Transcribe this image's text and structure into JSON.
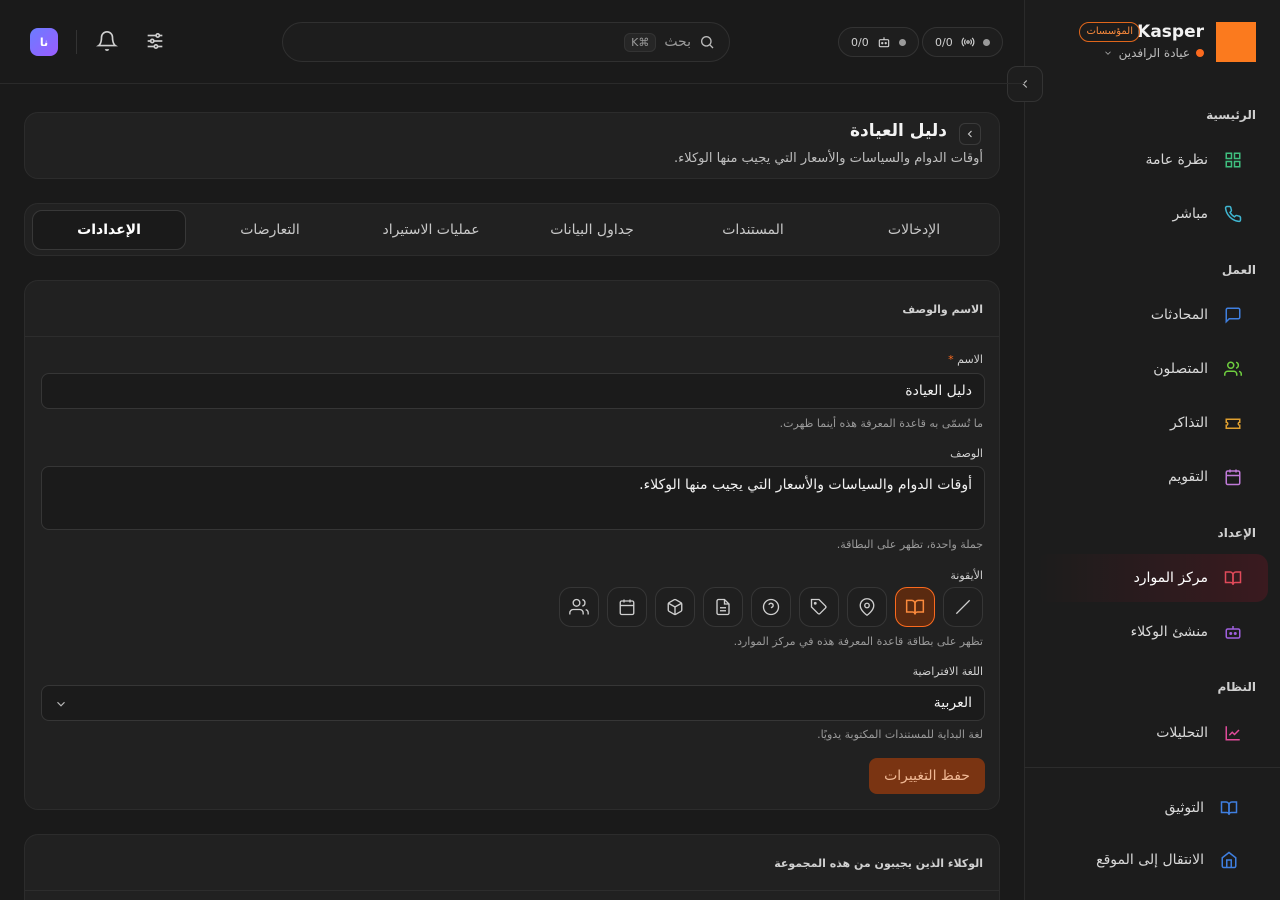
{
  "brand": {
    "name": "Kasper",
    "badge": "المؤسسات",
    "org": "عيادة الرافدين",
    "logo_color": "#fb7a1e"
  },
  "topbar": {
    "search_label": "بحث",
    "search_kbd": "⌘K",
    "stat1": "0/0",
    "stat2": "0/0",
    "avatar_text": "نا"
  },
  "sidebar": {
    "sections": {
      "home": "الرئيسية",
      "work": "العمل",
      "setup": "الإعداد",
      "system": "النظام"
    },
    "items": {
      "overview": "نظرة عامة",
      "live": "مباشر",
      "conversations": "المحادثات",
      "contacts": "المتصلون",
      "tickets": "التذاكر",
      "calendar": "التقويم",
      "resources": "مركز الموارد",
      "agent_builder": "منشئ الوكلاء",
      "analytics": "التحليلات",
      "docs": "التوثيق",
      "go_to_site": "الانتقال إلى الموقع"
    }
  },
  "page": {
    "title": "دليل العيادة",
    "subtitle": "أوقات الدوام والسياسات والأسعار التي يجيب منها الوكلاء."
  },
  "tabs": [
    "الإدخالات",
    "المستندات",
    "جداول البيانات",
    "عمليات الاستيراد",
    "التعارضات",
    "الإعدادات"
  ],
  "active_tab": "الإعدادات",
  "form": {
    "section_title": "الاسم والوصف",
    "name_label": "الاسم",
    "required_mark": "*",
    "name_value": "دليل العيادة",
    "name_help": "ما تُسمّى به قاعدة المعرفة هذه أينما ظهرت.",
    "desc_label": "الوصف",
    "desc_value": "أوقات الدوام والسياسات والأسعار التي يجيب منها الوكلاء.",
    "desc_help": "جملة واحدة، تظهر على البطاقة.",
    "icon_label": "الأيقونة",
    "icon_options": [
      "slash-icon",
      "book-icon",
      "map-pin-icon",
      "tag-icon",
      "help-circle-icon",
      "file-text-icon",
      "package-icon",
      "calendar-icon",
      "users-icon"
    ],
    "icon_selected": "book-icon",
    "icon_help": "تظهر على بطاقة قاعدة المعرفة هذه في مركز الموارد.",
    "lang_label": "اللغة الافتراضية",
    "lang_value": "العربية",
    "lang_help": "لغة البداية للمستندات المكتوبة يدويًا.",
    "save_label": "حفظ التغييرات",
    "accent": "#fb6a1e"
  },
  "agents": {
    "section_title": "الوكلاء الذين يجيبون من هذه المجموعة"
  }
}
